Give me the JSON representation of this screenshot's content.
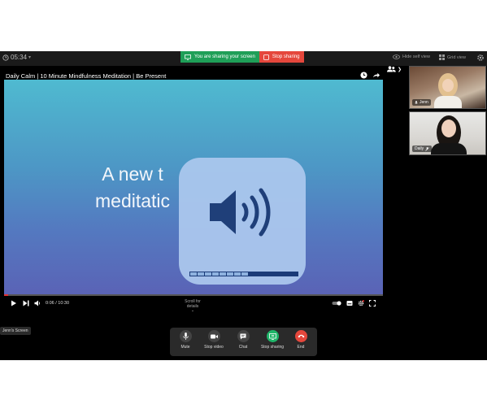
{
  "topbar": {
    "clock": "05:34",
    "sharing_notice": "You are sharing your screen",
    "stop_sharing": "Stop sharing",
    "hide_self_view": "Hide self view",
    "grid_view": "Grid view"
  },
  "video": {
    "title": "Daily Calm | 10 Minute Mindfulness Meditation | Be Present",
    "slide_line1": "A new t",
    "slide_line2": "meditatic",
    "time": "0:06 / 10:30",
    "scroll_hint": "Scroll for details",
    "progress_fraction": 0.01
  },
  "volume": {
    "level_fraction": 0.55
  },
  "screen_label": "Jenn's Screen",
  "participants": [
    {
      "name": "Jenn"
    },
    {
      "name": "Daily"
    }
  ],
  "tray": {
    "mute": "Mute",
    "stop_video": "Stop video",
    "chat": "Chat",
    "stop_sharing": "Stop sharing",
    "end": "End"
  },
  "colors": {
    "sharing_green": "#1f9f58",
    "stop_red": "#e5473c",
    "end_red": "#e5473c",
    "share_active_green": "#1fb569"
  }
}
